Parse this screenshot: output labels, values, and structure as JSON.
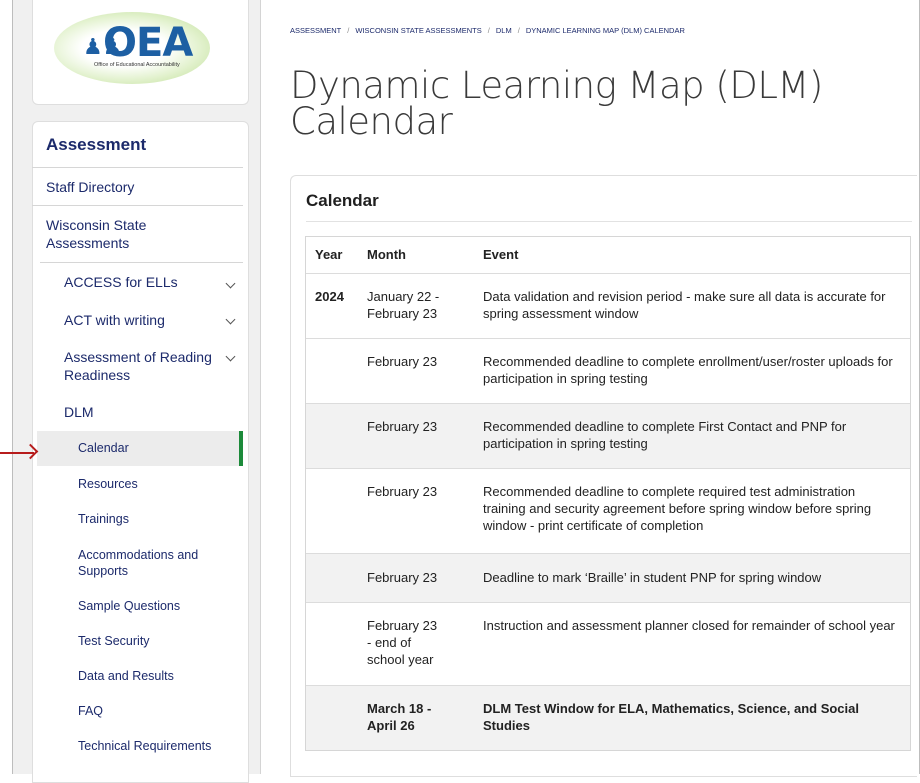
{
  "logo": {
    "text": "OEA",
    "subtitle": "Office of Educational Accountability"
  },
  "sidebar": {
    "title": "Assessment",
    "links": [
      "Staff Directory",
      "Wisconsin State Assessments"
    ],
    "groups": [
      {
        "label": "ACCESS for ELLs"
      },
      {
        "label": "ACT with writing"
      },
      {
        "label": "Assessment of Reading Readiness"
      },
      {
        "label": "DLM"
      }
    ],
    "dlm_items": [
      "Calendar",
      "Resources",
      "Trainings",
      "Accommodations and Supports",
      "Sample Questions",
      "Test Security",
      "Data and Results",
      "FAQ",
      "Technical Requirements"
    ]
  },
  "breadcrumb": [
    "Assessment",
    "Wisconsin State Assessments",
    "DLM",
    "Dynamic Learning Map (DLM) Calendar"
  ],
  "page_title": "Dynamic Learning Map (DLM) Calendar",
  "calendar": {
    "heading": "Calendar",
    "columns": [
      "Year",
      "Month",
      "Event"
    ],
    "rows": [
      {
        "year": "2024",
        "month": "January 22 - February 23",
        "event": "Data validation and revision period - make sure all data is accurate for spring assessment window"
      },
      {
        "year": "",
        "month": "February 23",
        "event": "Recommended deadline to complete enrollment/user/roster uploads for participation in spring testing"
      },
      {
        "year": "",
        "month": "February 23",
        "event": "Recommended deadline to complete First Contact and PNP for participation in spring testing"
      },
      {
        "year": "",
        "month": "February 23",
        "event": "Recommended deadline to complete required test administration training and security agreement before spring window before spring window - print certificate of completion"
      },
      {
        "year": "",
        "month": "February 23",
        "event": "Deadline to mark ‘Braille’ in student PNP for spring window"
      },
      {
        "year": "",
        "month": "February 23 - end of school year",
        "event": "Instruction and assessment planner closed for remainder of school year"
      },
      {
        "year": "",
        "month": "March 18 - April 26",
        "event": "DLM Test Window for ELA, Mathematics, Science, and Social Studies"
      }
    ]
  },
  "colors": {
    "nav_text": "#1c2a6b",
    "active_indicator": "#1c8a3a",
    "annotation_arrow": "#b71c1c"
  }
}
